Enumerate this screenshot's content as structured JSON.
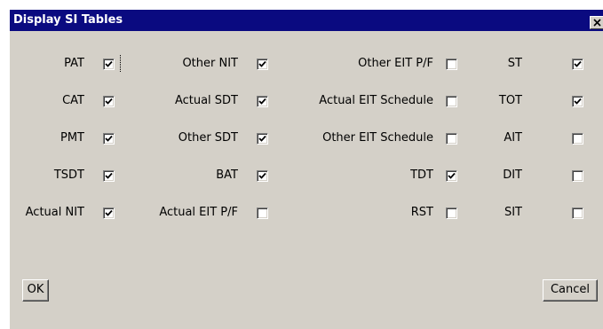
{
  "window": {
    "title": "Display SI Tables"
  },
  "tables": [
    {
      "label": "PAT",
      "checked": true
    },
    {
      "label": "CAT",
      "checked": true
    },
    {
      "label": "PMT",
      "checked": true
    },
    {
      "label": "TSDT",
      "checked": true
    },
    {
      "label": "Actual NIT",
      "checked": true
    },
    {
      "label": "Other NIT",
      "checked": true
    },
    {
      "label": "Actual SDT",
      "checked": true
    },
    {
      "label": "Other SDT",
      "checked": true
    },
    {
      "label": "BAT",
      "checked": true
    },
    {
      "label": "Actual EIT P/F",
      "checked": false
    },
    {
      "label": "Other EIT P/F",
      "checked": false
    },
    {
      "label": "Actual EIT Schedule",
      "checked": false
    },
    {
      "label": "Other EIT Schedule",
      "checked": false
    },
    {
      "label": "TDT",
      "checked": true
    },
    {
      "label": "RST",
      "checked": false
    },
    {
      "label": "ST",
      "checked": true
    },
    {
      "label": "TOT",
      "checked": true
    },
    {
      "label": "AIT",
      "checked": false
    },
    {
      "label": "DIT",
      "checked": false
    },
    {
      "label": "SIT",
      "checked": false
    }
  ],
  "buttons": {
    "ok_label": "OK",
    "cancel_label": "Cancel"
  },
  "icons": {
    "close": "close-icon",
    "check": "checkmark-icon"
  },
  "colors": {
    "titlebar": "#0a0a80",
    "dialog_face": "#d4d0c8"
  }
}
